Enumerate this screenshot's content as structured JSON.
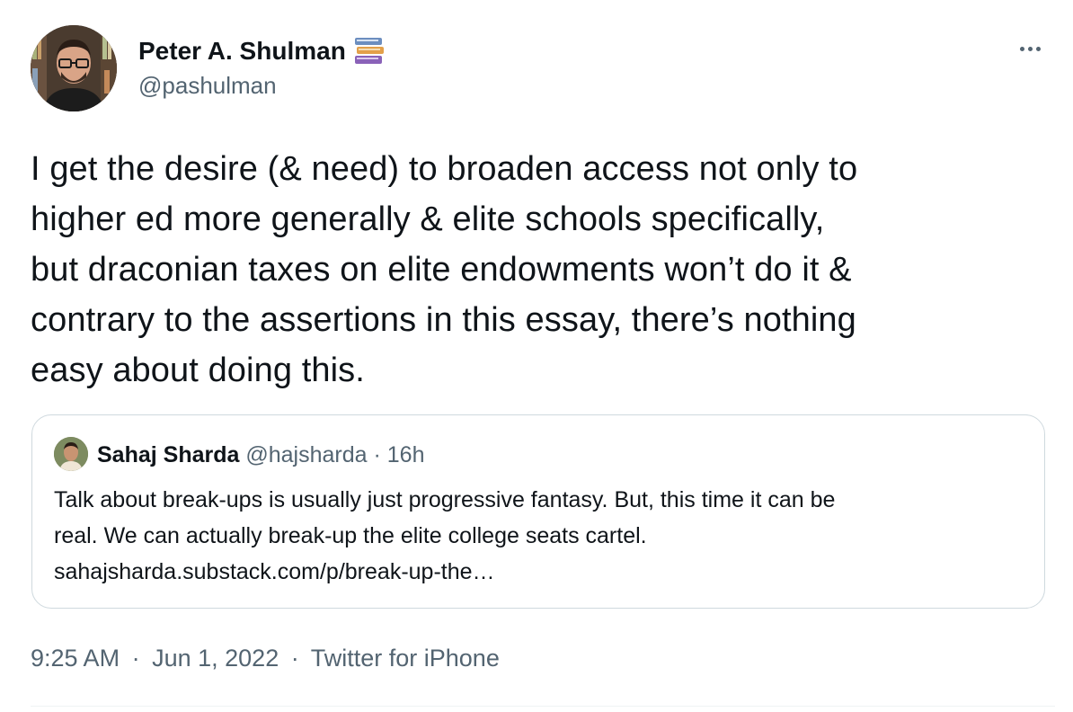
{
  "tweet": {
    "author": {
      "name": "Peter A. Shulman",
      "handle": "@pashulman",
      "name_emoji": "books-icon",
      "avatar": "avatar"
    },
    "more_icon": "more-horizontal-icon",
    "text": "I get the desire (& need) to broaden access not only to\nhigher ed more generally & elite schools specifically,\nbut draconian taxes on elite endowments won’t do it &\ncontrary to the assertions in this essay, there’s nothing\neasy about doing this.",
    "quote": {
      "name": "Sahaj Sharda",
      "handle": "@hajsharda",
      "separator": "·",
      "time": "16h",
      "text_line1": "Talk about break-ups is usually just progressive fantasy. But, this time it can be",
      "text_line2": "real. We can actually break-up the elite college seats cartel.",
      "link": "sahajsharda.substack.com/p/break-up-the…"
    },
    "footer": {
      "time": "9:25 AM",
      "date": "Jun 1, 2022",
      "source": "Twitter for iPhone",
      "separator": "·"
    }
  },
  "colors": {
    "text_primary": "#0f1419",
    "text_secondary": "#536471",
    "border": "#cfd9de"
  }
}
